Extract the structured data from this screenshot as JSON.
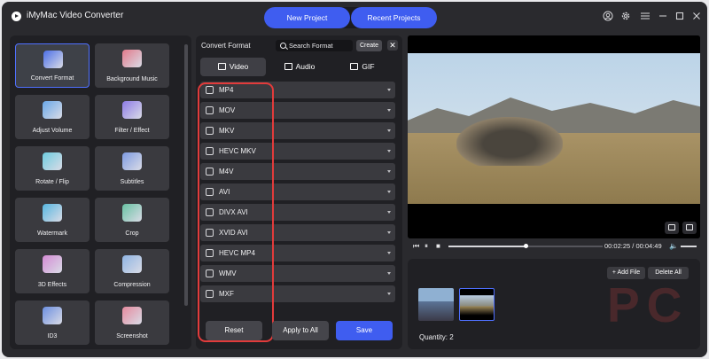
{
  "app": {
    "title": "iMyMac Video Converter"
  },
  "top_tabs": {
    "new_project": "New Project",
    "recent_projects": "Recent Projects"
  },
  "window_icons": [
    "user-icon",
    "gear-icon",
    "menu-icon",
    "minimize-icon",
    "maximize-icon",
    "close-icon"
  ],
  "tools": [
    {
      "label": "Convert Format",
      "icon": "convert-icon",
      "active": true
    },
    {
      "label": "Background Music",
      "icon": "music-icon",
      "active": false
    },
    {
      "label": "Adjust Volume",
      "icon": "volume-icon",
      "active": false
    },
    {
      "label": "Filter / Effect",
      "icon": "filter-icon",
      "active": false
    },
    {
      "label": "Rotate / Flip",
      "icon": "rotate-icon",
      "active": false
    },
    {
      "label": "Subtitles",
      "icon": "subtitles-icon",
      "active": false
    },
    {
      "label": "Watermark",
      "icon": "watermark-icon",
      "active": false
    },
    {
      "label": "Crop",
      "icon": "crop-icon",
      "active": false
    },
    {
      "label": "3D Effects",
      "icon": "3d-glasses-icon",
      "active": false
    },
    {
      "label": "Compression",
      "icon": "compression-icon",
      "active": false
    },
    {
      "label": "ID3",
      "icon": "id3-icon",
      "active": false
    },
    {
      "label": "Screenshot",
      "icon": "screenshot-icon",
      "active": false
    }
  ],
  "convert": {
    "title": "Convert Format",
    "search_placeholder": "Search Format",
    "create_label": "Create",
    "close_label": "✕",
    "categories": [
      "Video",
      "Audio",
      "GIF"
    ],
    "formats": [
      "MP4",
      "MOV",
      "MKV",
      "HEVC MKV",
      "M4V",
      "AVI",
      "DIVX AVI",
      "XVID AVI",
      "HEVC MP4",
      "WMV",
      "MXF"
    ],
    "buttons": {
      "reset": "Reset",
      "apply_all": "Apply to All",
      "save": "Save"
    }
  },
  "player": {
    "current_time": "00:02:25",
    "total_time": "00:04:49",
    "time_display": "00:02:25 / 00:04:49",
    "progress": 0.5
  },
  "files": {
    "add_file": "+ Add File",
    "delete_all": "Delete All",
    "quantity": "Quantity: 2"
  },
  "watermark_text": "PC",
  "colors": {
    "accent": "#3f5df0",
    "highlight": "#e23b3b"
  }
}
